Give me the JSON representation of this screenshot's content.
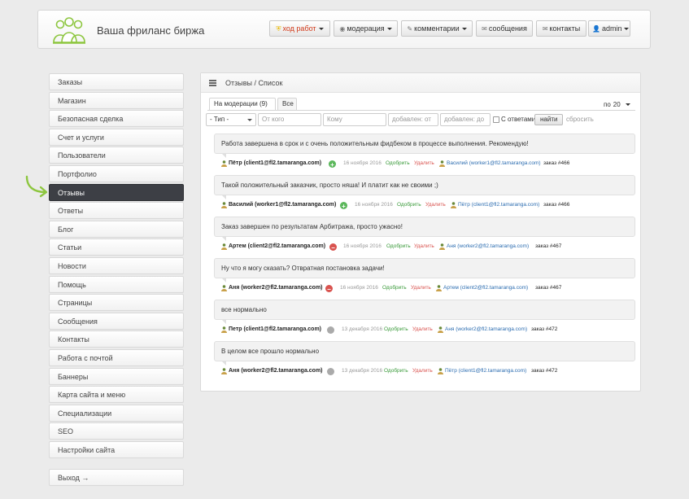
{
  "header": {
    "title": "Ваша фриланс биржа",
    "nav": [
      {
        "label": "ход работ",
        "icon": "shield-icon"
      },
      {
        "label": "модерация",
        "icon": "eye-icon"
      },
      {
        "label": "комментарии",
        "icon": "pencil-icon"
      },
      {
        "label": "сообщения",
        "icon": "envelope-icon"
      },
      {
        "label": "контакты",
        "icon": "envelope-icon"
      },
      {
        "label": "admin",
        "icon": "user-icon"
      }
    ]
  },
  "sidebar": {
    "items": [
      {
        "label": "Заказы"
      },
      {
        "label": "Магазин"
      },
      {
        "label": "Безопасная сделка"
      },
      {
        "label": "Счет и услуги"
      },
      {
        "label": "Пользователи"
      },
      {
        "label": "Портфолио"
      },
      {
        "label": "Отзывы",
        "active": true
      },
      {
        "label": "Ответы"
      },
      {
        "label": "Блог"
      },
      {
        "label": "Статьи"
      },
      {
        "label": "Новости"
      },
      {
        "label": "Помощь"
      },
      {
        "label": "Страницы"
      },
      {
        "label": "Сообщения"
      },
      {
        "label": "Контакты"
      },
      {
        "label": "Работа с почтой"
      },
      {
        "label": "Баннеры"
      },
      {
        "label": "Карта сайта и меню"
      },
      {
        "label": "Специализации"
      },
      {
        "label": "SEO"
      },
      {
        "label": "Настройки сайта"
      }
    ],
    "logout": "Выход →"
  },
  "main": {
    "breadcrumb": "Отзывы / Список",
    "tabs": [
      {
        "label": "На модерации (9)",
        "active": true
      },
      {
        "label": "Все",
        "active": false
      }
    ],
    "per_page": {
      "label": "по",
      "value": "20"
    },
    "filters": {
      "type": "- Тип -",
      "from_placeholder": "От кого",
      "to_placeholder": "Кому",
      "added_from_placeholder": "добавлен: от",
      "added_to_placeholder": "добавлен: до",
      "with_answers_label": "С ответами",
      "find_label": "найти",
      "reset_label": "сбросить"
    },
    "actions": {
      "approve": "Одобрить",
      "delete": "Удалить"
    },
    "reviews": [
      {
        "text": "Работа завершена в срок и с очень положительным фидбеком в процессе выполнения. Рекомендую!",
        "author": "Пётр (client1@fl2.tamaranga.com)",
        "status": "plus",
        "date": "16 ноября 2016",
        "target": "Василий (worker1@fl2.tamaranga.com)",
        "order": "заказ #466"
      },
      {
        "text": "Такой положительный заказчик, просто няша! И платит как не своими ;)",
        "author": "Василий (worker1@fl2.tamaranga.com)",
        "status": "plus",
        "date": "16 ноября 2016",
        "target": "Пётр (client1@fl2.tamaranga.com)",
        "order": "заказ #466"
      },
      {
        "text": "Заказ завершен по результатам Арбитража, просто ужасно!",
        "author": "Артем (client2@fl2.tamaranga.com)",
        "status": "minus",
        "date": "16 ноября 2016",
        "target": "Аня (worker2@fl2.tamaranga.com)",
        "order": "заказ #467"
      },
      {
        "text": "Ну что я могу сказать? Отвратная постановка задачи!",
        "author": "Аня (worker2@fl2.tamaranga.com)",
        "status": "minus",
        "date": "16 ноября 2016",
        "target": "Артем (client2@fl2.tamaranga.com)",
        "order": "заказ #467"
      },
      {
        "text": "все нормально",
        "author": "Петр (client1@fl2.tamaranga.com)",
        "status": "neutral",
        "date": "13 декабря 2016",
        "target": "Аня (worker2@fl2.tamaranga.com)",
        "order": "заказ #472"
      },
      {
        "text": "В целом все прошло нормально",
        "author": "Аня (worker2@fl2.tamaranga.com)",
        "status": "neutral",
        "date": "13 декабря 2016",
        "target": "Пётр (client1@fl2.tamaranga.com)",
        "order": "заказ #472"
      }
    ]
  },
  "colors": {
    "active_sidebar": "#3d3f45",
    "status_plus": "#5cb85c",
    "status_minus": "#d9534f",
    "status_neutral": "#aaaaaa",
    "link": "#2b6cb0",
    "arrow": "#8dc63f"
  }
}
